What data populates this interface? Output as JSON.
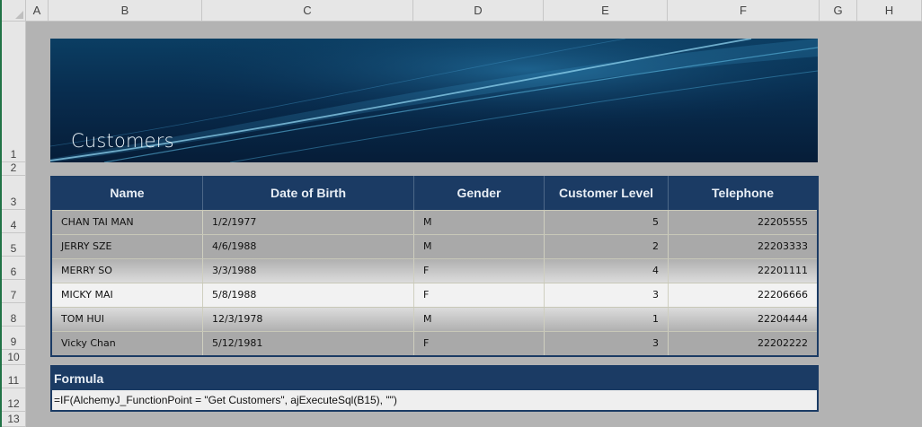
{
  "columns": [
    "A",
    "B",
    "C",
    "D",
    "E",
    "F",
    "G",
    "H"
  ],
  "rows": [
    "1",
    "2",
    "3",
    "4",
    "5",
    "6",
    "7",
    "8",
    "9",
    "10",
    "11",
    "12",
    "13"
  ],
  "banner": {
    "title": "Customers"
  },
  "table": {
    "headers": [
      "Name",
      "Date of Birth",
      "Gender",
      "Customer Level",
      "Telephone"
    ],
    "rows": [
      [
        "CHAN TAI MAN",
        "1/2/1977",
        "M",
        "5",
        "22205555"
      ],
      [
        "JERRY SZE",
        "4/6/1988",
        "M",
        "2",
        "22203333"
      ],
      [
        "MERRY SO",
        "3/3/1988",
        "F",
        "4",
        "22201111"
      ],
      [
        "MICKY MAI",
        "5/8/1988",
        "F",
        "3",
        "22206666"
      ],
      [
        "TOM HUI",
        "12/3/1978",
        "M",
        "1",
        "22204444"
      ],
      [
        "Vicky Chan",
        "5/12/1981",
        "F",
        "3",
        "22202222"
      ]
    ]
  },
  "formula": {
    "label": "Formula",
    "text": "=IF(AlchemyJ_FunctionPoint = \"Get Customers\", ajExecuteSql(B15), \"\")"
  },
  "colors": {
    "header_navy": "#1b3b64",
    "sheet_gray": "#b3b3b3",
    "highlight_row": "#f2f2f2"
  }
}
